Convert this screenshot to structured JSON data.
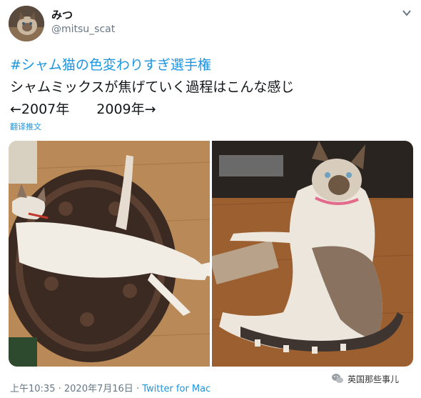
{
  "author": {
    "display_name": "みつ",
    "handle": "@mitsu_scat"
  },
  "tweet": {
    "hashtag_line": "#シャム猫の色変わりすぎ選手権",
    "text_line": "シャムミックスが焦げていく過程はこんな感じ",
    "years_line": "←2007年　　2009年→",
    "translate_label": "翻译推文"
  },
  "photos": {
    "left_icon": "cat-photo-2007",
    "right_icon": "cat-photo-2009"
  },
  "footer": {
    "time": "上午10:35",
    "separator": "·",
    "date": "2020年7月16日",
    "source": "Twitter for Mac"
  },
  "watermark": {
    "text": "英国那些事儿",
    "icon": "wechat-icon"
  },
  "colors": {
    "link_blue": "#1b95e0",
    "text_dark": "#14171a",
    "text_gray": "#657786"
  }
}
